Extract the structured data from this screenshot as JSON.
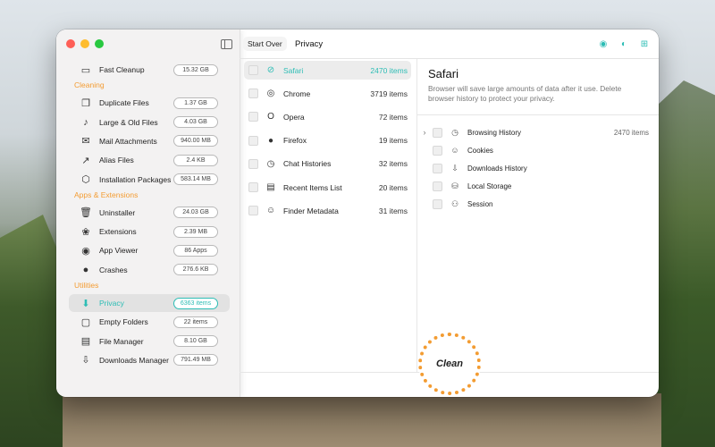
{
  "sidebar": {
    "items": [
      {
        "icon": "monitor-icon",
        "glyph": "▭",
        "label": "Fast Cleanup",
        "badge": "15.32 GB"
      },
      {
        "section": "Cleaning"
      },
      {
        "icon": "duplicate-files-icon",
        "glyph": "❐",
        "label": "Duplicate Files",
        "badge": "1.37 GB"
      },
      {
        "icon": "large-files-icon",
        "glyph": "♪",
        "label": "Large & Old Files",
        "badge": "4.03 GB"
      },
      {
        "icon": "mail-icon",
        "glyph": "✉",
        "label": "Mail Attachments",
        "badge": "940.00 MB"
      },
      {
        "icon": "alias-icon",
        "glyph": "↗",
        "label": "Alias Files",
        "badge": "2.4 KB"
      },
      {
        "icon": "package-icon",
        "glyph": "⬡",
        "label": "Installation Packages",
        "badge": "583.14 MB"
      },
      {
        "section": "Apps & Extensions"
      },
      {
        "icon": "trash-icon",
        "glyph": "🗑",
        "label": "Uninstaller",
        "badge": "24.03 GB"
      },
      {
        "icon": "extensions-icon",
        "glyph": "❀",
        "label": "Extensions",
        "badge": "2.39 MB"
      },
      {
        "icon": "app-viewer-icon",
        "glyph": "◉",
        "label": "App Viewer",
        "badge": "86 Apps"
      },
      {
        "icon": "crash-icon",
        "glyph": "●",
        "label": "Crashes",
        "badge": "276.6 KB"
      },
      {
        "section": "Utilities"
      },
      {
        "icon": "privacy-icon",
        "glyph": "⬇",
        "label": "Privacy",
        "badge": "6363 items",
        "active": true
      },
      {
        "icon": "folder-icon",
        "glyph": "▢",
        "label": "Empty Folders",
        "badge": "22 items"
      },
      {
        "icon": "file-manager-icon",
        "glyph": "▤",
        "label": "File Manager",
        "badge": "8.10 GB"
      },
      {
        "icon": "download-icon",
        "glyph": "⇩",
        "label": "Downloads Manager",
        "badge": "791.49 MB"
      }
    ]
  },
  "toolbar": {
    "start_over": "Start Over",
    "title": "Privacy"
  },
  "apps": [
    {
      "name": "Safari",
      "count": "2470 items",
      "icon": "safari-icon",
      "glyph": "⊘",
      "selected": true
    },
    {
      "name": "Chrome",
      "count": "3719 items",
      "icon": "chrome-icon",
      "glyph": "◎"
    },
    {
      "name": "Opera",
      "count": "72 items",
      "icon": "opera-icon",
      "glyph": "O"
    },
    {
      "name": "Firefox",
      "count": "19 items",
      "icon": "firefox-icon",
      "glyph": "●"
    },
    {
      "name": "Chat Histories",
      "count": "32 items",
      "icon": "clock-icon",
      "glyph": "◷"
    },
    {
      "name": "Recent Items List",
      "count": "20 items",
      "icon": "list-icon",
      "glyph": "▤"
    },
    {
      "name": "Finder Metadata",
      "count": "31 items",
      "icon": "finder-icon",
      "glyph": "☺"
    }
  ],
  "detail": {
    "title": "Safari",
    "description": "Browser will save large amounts of data after it use. Delete browser history to protect your privacy.",
    "rows": [
      {
        "name": "Browsing History",
        "count": "2470 items",
        "icon": "history-icon",
        "glyph": "◷",
        "expandable": true
      },
      {
        "name": "Cookies",
        "count": "",
        "icon": "cookie-icon",
        "glyph": "☺"
      },
      {
        "name": "Downloads History",
        "count": "",
        "icon": "downloads-icon",
        "glyph": "⇩"
      },
      {
        "name": "Local Storage",
        "count": "",
        "icon": "storage-icon",
        "glyph": "⛁"
      },
      {
        "name": "Session",
        "count": "",
        "icon": "session-icon",
        "glyph": "⚇"
      }
    ]
  },
  "clean_button": "Clean",
  "colors": {
    "accent": "#2dbdb5",
    "section": "#f39c32"
  }
}
